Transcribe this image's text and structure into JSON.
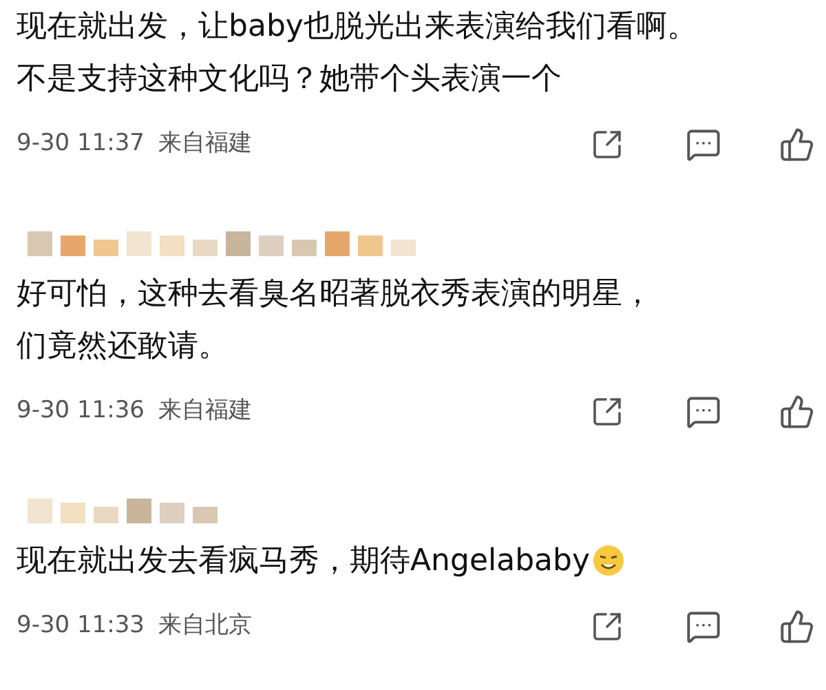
{
  "comments": [
    {
      "name_hidden": false,
      "lines": [
        "现在就出发，让baby也脱光出来表演给我们看啊。",
        "不是支持这种文化吗？她带个头表演一个"
      ],
      "has_emoji": false,
      "time": "9-30 11:37",
      "location": "来自福建"
    },
    {
      "name_hidden": true,
      "lines": [
        "好可怕，这种去看臭名昭著脱衣秀表演的明星，",
        "们竟然还敢请。"
      ],
      "has_emoji": false,
      "time": "9-30 11:36",
      "location": "来自福建"
    },
    {
      "name_hidden": true,
      "lines": [
        "现在就出发去看疯马秀，期待Angelababy"
      ],
      "has_emoji": true,
      "time": "9-30 11:33",
      "location": "来自北京"
    }
  ]
}
